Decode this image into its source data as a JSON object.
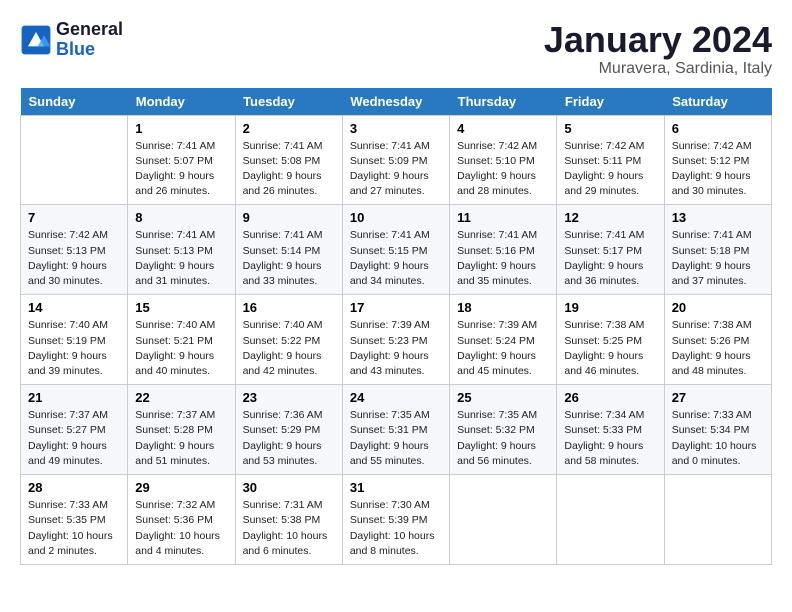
{
  "header": {
    "logo_line1": "General",
    "logo_line2": "Blue",
    "month_title": "January 2024",
    "location": "Muravera, Sardinia, Italy"
  },
  "weekdays": [
    "Sunday",
    "Monday",
    "Tuesday",
    "Wednesday",
    "Thursday",
    "Friday",
    "Saturday"
  ],
  "weeks": [
    [
      {
        "day": "",
        "sunrise": "",
        "sunset": "",
        "daylight": ""
      },
      {
        "day": "1",
        "sunrise": "7:41 AM",
        "sunset": "5:07 PM",
        "daylight": "9 hours and 26 minutes."
      },
      {
        "day": "2",
        "sunrise": "7:41 AM",
        "sunset": "5:08 PM",
        "daylight": "9 hours and 26 minutes."
      },
      {
        "day": "3",
        "sunrise": "7:41 AM",
        "sunset": "5:09 PM",
        "daylight": "9 hours and 27 minutes."
      },
      {
        "day": "4",
        "sunrise": "7:42 AM",
        "sunset": "5:10 PM",
        "daylight": "9 hours and 28 minutes."
      },
      {
        "day": "5",
        "sunrise": "7:42 AM",
        "sunset": "5:11 PM",
        "daylight": "9 hours and 29 minutes."
      },
      {
        "day": "6",
        "sunrise": "7:42 AM",
        "sunset": "5:12 PM",
        "daylight": "9 hours and 30 minutes."
      }
    ],
    [
      {
        "day": "7",
        "sunrise": "7:42 AM",
        "sunset": "5:13 PM",
        "daylight": "9 hours and 30 minutes."
      },
      {
        "day": "8",
        "sunrise": "7:41 AM",
        "sunset": "5:13 PM",
        "daylight": "9 hours and 31 minutes."
      },
      {
        "day": "9",
        "sunrise": "7:41 AM",
        "sunset": "5:14 PM",
        "daylight": "9 hours and 33 minutes."
      },
      {
        "day": "10",
        "sunrise": "7:41 AM",
        "sunset": "5:15 PM",
        "daylight": "9 hours and 34 minutes."
      },
      {
        "day": "11",
        "sunrise": "7:41 AM",
        "sunset": "5:16 PM",
        "daylight": "9 hours and 35 minutes."
      },
      {
        "day": "12",
        "sunrise": "7:41 AM",
        "sunset": "5:17 PM",
        "daylight": "9 hours and 36 minutes."
      },
      {
        "day": "13",
        "sunrise": "7:41 AM",
        "sunset": "5:18 PM",
        "daylight": "9 hours and 37 minutes."
      }
    ],
    [
      {
        "day": "14",
        "sunrise": "7:40 AM",
        "sunset": "5:19 PM",
        "daylight": "9 hours and 39 minutes."
      },
      {
        "day": "15",
        "sunrise": "7:40 AM",
        "sunset": "5:21 PM",
        "daylight": "9 hours and 40 minutes."
      },
      {
        "day": "16",
        "sunrise": "7:40 AM",
        "sunset": "5:22 PM",
        "daylight": "9 hours and 42 minutes."
      },
      {
        "day": "17",
        "sunrise": "7:39 AM",
        "sunset": "5:23 PM",
        "daylight": "9 hours and 43 minutes."
      },
      {
        "day": "18",
        "sunrise": "7:39 AM",
        "sunset": "5:24 PM",
        "daylight": "9 hours and 45 minutes."
      },
      {
        "day": "19",
        "sunrise": "7:38 AM",
        "sunset": "5:25 PM",
        "daylight": "9 hours and 46 minutes."
      },
      {
        "day": "20",
        "sunrise": "7:38 AM",
        "sunset": "5:26 PM",
        "daylight": "9 hours and 48 minutes."
      }
    ],
    [
      {
        "day": "21",
        "sunrise": "7:37 AM",
        "sunset": "5:27 PM",
        "daylight": "9 hours and 49 minutes."
      },
      {
        "day": "22",
        "sunrise": "7:37 AM",
        "sunset": "5:28 PM",
        "daylight": "9 hours and 51 minutes."
      },
      {
        "day": "23",
        "sunrise": "7:36 AM",
        "sunset": "5:29 PM",
        "daylight": "9 hours and 53 minutes."
      },
      {
        "day": "24",
        "sunrise": "7:35 AM",
        "sunset": "5:31 PM",
        "daylight": "9 hours and 55 minutes."
      },
      {
        "day": "25",
        "sunrise": "7:35 AM",
        "sunset": "5:32 PM",
        "daylight": "9 hours and 56 minutes."
      },
      {
        "day": "26",
        "sunrise": "7:34 AM",
        "sunset": "5:33 PM",
        "daylight": "9 hours and 58 minutes."
      },
      {
        "day": "27",
        "sunrise": "7:33 AM",
        "sunset": "5:34 PM",
        "daylight": "10 hours and 0 minutes."
      }
    ],
    [
      {
        "day": "28",
        "sunrise": "7:33 AM",
        "sunset": "5:35 PM",
        "daylight": "10 hours and 2 minutes."
      },
      {
        "day": "29",
        "sunrise": "7:32 AM",
        "sunset": "5:36 PM",
        "daylight": "10 hours and 4 minutes."
      },
      {
        "day": "30",
        "sunrise": "7:31 AM",
        "sunset": "5:38 PM",
        "daylight": "10 hours and 6 minutes."
      },
      {
        "day": "31",
        "sunrise": "7:30 AM",
        "sunset": "5:39 PM",
        "daylight": "10 hours and 8 minutes."
      },
      {
        "day": "",
        "sunrise": "",
        "sunset": "",
        "daylight": ""
      },
      {
        "day": "",
        "sunrise": "",
        "sunset": "",
        "daylight": ""
      },
      {
        "day": "",
        "sunrise": "",
        "sunset": "",
        "daylight": ""
      }
    ]
  ]
}
